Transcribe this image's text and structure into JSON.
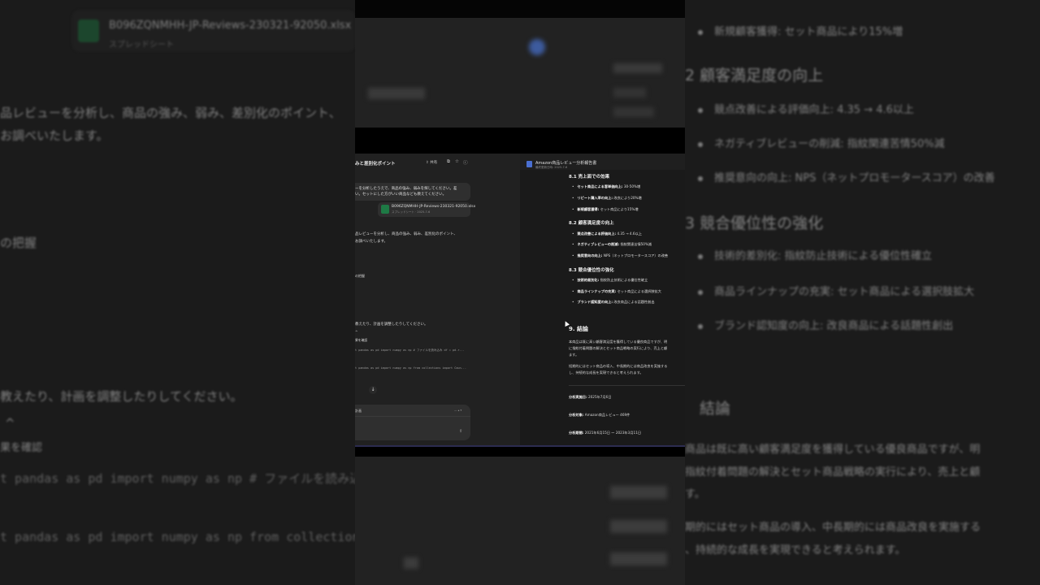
{
  "bg_left": {
    "file_name": "B096ZQNMHH-JP-Reviews-230321-92050.xlsx",
    "file_type": "スプレッドシート",
    "lines": [
      "品レビューを分析し、商品の強み、弱み、差別化のポイント、",
      "お調べいたします。",
      "の把握",
      "教えたり、計画を調整したりしてください。",
      "^",
      "果を確認"
    ],
    "code": [
      "t pandas as pd import numpy as np # ファイルを読み込み df = pd.read_",
      "t pandas as pd import numpy as np from collections import Coun"
    ]
  },
  "bg_right": {
    "top_bullet": "新規顧客獲得: セット商品により15%増",
    "h2": "2 顧客満足度の向上",
    "b2": [
      "競点改善による評価向上: 4.35 → 4.6以上",
      "ネガティブレビューの削減: 指紋関連苦情50%減",
      "推奨意向の向上: NPS（ネットプロモータースコア）の改善"
    ],
    "h3": "3 競合優位性の強化",
    "b3": [
      "技術的差別化: 指紋防止技術による優位性確立",
      "商品ラインナップの充実: セット商品による選択肢拡大",
      "ブランド認知度の向上: 改良商品による話題性創出"
    ],
    "h9": "結論",
    "p1a": "商品は既に高い顧客満足度を獲得している優良商品ですが、明",
    "p1b": "指紋付着問題の解決とセット商品戦略の実行により、売上と顧",
    "p1c": "す。",
    "p2a": "期的にはセット商品の導入、中長期的には商品改良を実施する",
    "p2b": "、持続的な成長を実現できると考えられます。"
  },
  "chat": {
    "title": "みと差別化ポイント",
    "share": "共有",
    "user_msg_1": "ーを分析したうえで、商品の強み、弱みを探してください。差",
    "user_msg_2": "い。セットにした方がいい商品なども教えてください。",
    "attachment_name": "B096ZQNMHH-JP-Reviews-230321-92050.xlsx",
    "attachment_type": "スプレッドシート · 2025-7-6",
    "reply_1": "品レビューを分析し、商品の強み、弱み、差別化のポイント、",
    "reply_2": "お調べいたします。",
    "reply_3": "の把握",
    "reply_4": "教えたり、計画を調整したりしてください。",
    "reply_5": "^",
    "reply_6": "果を確認",
    "code_1": "t pandas as pd import numpy as np # ファイルを読み込み df = pd.r...",
    "code_2": "t pandas as pd import numpy as np from collections import Coun...",
    "scroll_glyph": "↓",
    "composer_label": "計画",
    "composer_ctrl": "— ▴ ▾",
    "composer_send": "⇧"
  },
  "doc": {
    "title": "Amazon商品レビュー分析報告書",
    "subtitle": "最終更新日時: 2025-7-6",
    "s81": "8.1 売上面での効果",
    "s81_items": [
      {
        "label": "セット商品による客単価向上:",
        "value": " 30-50%増"
      },
      {
        "label": "リピート購入率の向上:",
        "value": " 改良により20%増"
      },
      {
        "label": "新規顧客獲得:",
        "value": " セット商品により15%増"
      }
    ],
    "s82": "8.2 顧客満足度の向上",
    "s82_items": [
      {
        "label": "競点改善による評価向上:",
        "value": " 4.35 → 4.6以上"
      },
      {
        "label": "ネガティブレビューの削減:",
        "value": " 指紋関連苦情50%減"
      },
      {
        "label": "推奨意向の向上:",
        "value": " NPS（ネットプロモータースコア）の改善"
      }
    ],
    "s83": "8.3 競合優位性の強化",
    "s83_items": [
      {
        "label": "技術的差別化:",
        "value": " 指紋防止技術による優位性確立"
      },
      {
        "label": "商品ラインナップの充実:",
        "value": " セット商品による選択肢拡大"
      },
      {
        "label": "ブランド認知度の向上:",
        "value": " 改良商品による話題性創出"
      }
    ],
    "s9": "9. 結論",
    "p1_1": "本商品は既に高い顧客満足度を獲得している優良商品ですが、明",
    "p1_2": "に指紋付着問題の解決とセット商品戦略の実行により、売上と顧",
    "p1_3": "ます。",
    "p2_1": "短期的にはセット商品の導入、中長期的には商品改良を実施する",
    "p2_2": "し、持続的な成長を実現できると考えられます。",
    "meta": [
      {
        "label": "分析実施日:",
        "value": " 2025年7月6日"
      },
      {
        "label": "分析対象:",
        "value": " Amazon商品レビュー 469件"
      },
      {
        "label": "分析期間:",
        "value": " 2021年6月15日 ～ 2023年3月11日"
      }
    ]
  }
}
